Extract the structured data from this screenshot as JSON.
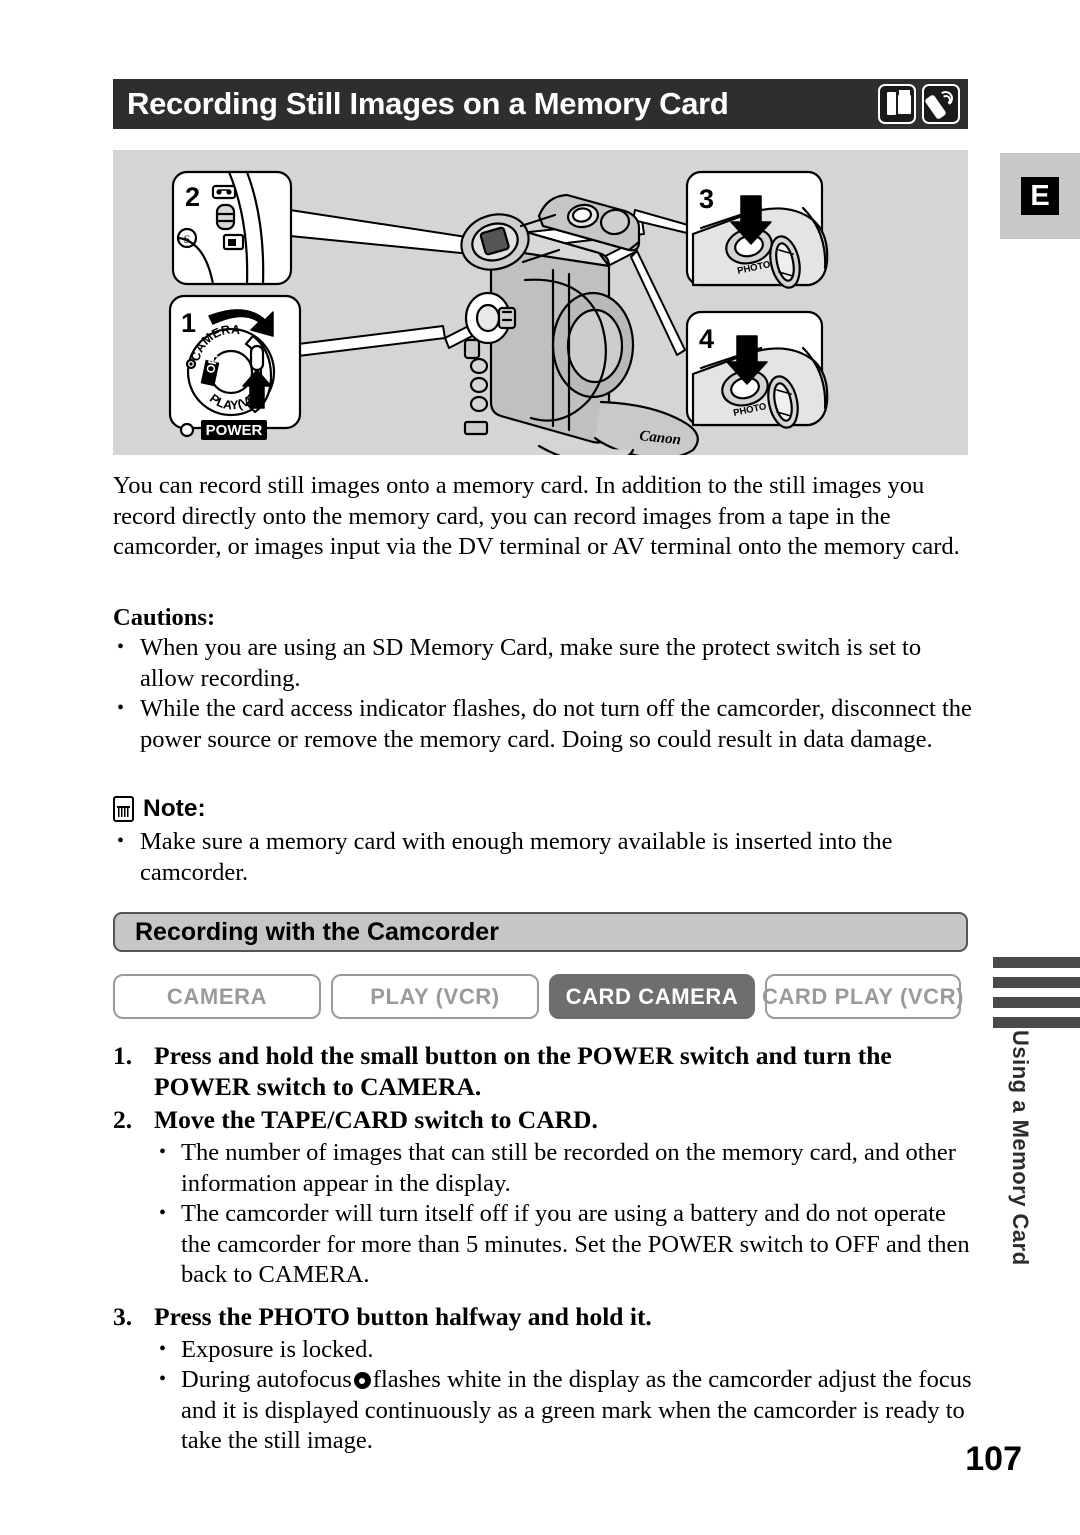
{
  "page": {
    "title": "Recording Still Images on a Memory Card",
    "number": "107",
    "language_tab": "E",
    "side_tab_text": "Using a Memory Card"
  },
  "header_icons": [
    {
      "name": "memory-card-icon",
      "label": "memory card"
    },
    {
      "name": "remote-control-icon",
      "label": "wireless remote"
    }
  ],
  "illustration": {
    "callouts": [
      {
        "number": "1",
        "label_power": "POWER",
        "dial_labels": [
          "CAMERA",
          "OFF",
          "PLAY(VCR)"
        ]
      },
      {
        "number": "2",
        "switch_labels": [
          "S"
        ]
      },
      {
        "number": "3",
        "button_label": "PHOTO"
      },
      {
        "number": "4",
        "button_label": "PHOTO"
      }
    ],
    "brand": "Canon"
  },
  "intro": "You can record still images onto a memory card. In addition to the still images you record directly onto the memory card, you can record images from a tape in the camcorder, or images input via the DV terminal or AV terminal onto the memory card.",
  "cautions": {
    "heading": "Cautions:",
    "items": [
      "When you are using an SD Memory Card, make sure the protect switch is set to allow recording.",
      "While the card access indicator flashes, do not turn off the camcorder, disconnect the power source or remove the memory card. Doing so could result in data damage."
    ]
  },
  "note": {
    "heading": "Note:",
    "icon": "memory-card-icon",
    "items": [
      "Make sure a memory card with enough memory available is inserted into the camcorder."
    ]
  },
  "section": {
    "heading": "Recording with the Camcorder"
  },
  "modes": [
    {
      "label": "CAMERA",
      "active": false
    },
    {
      "label": "PLAY (VCR)",
      "active": false
    },
    {
      "label": "CARD CAMERA",
      "active": true
    },
    {
      "label": "CARD PLAY (VCR)",
      "active": false
    }
  ],
  "steps": [
    {
      "number": "1.",
      "text": "Press and hold the small button on the POWER switch and turn the POWER switch to CAMERA.",
      "bullets": []
    },
    {
      "number": "2.",
      "text": "Move the TAPE/CARD switch to CARD.",
      "bullets": [
        "The number of images that can still be recorded on the memory card, and other information appear in the display.",
        "The camcorder will turn itself off if you are using a battery and do not operate the camcorder for more than 5 minutes. Set the POWER switch to OFF and then back to CAMERA."
      ]
    },
    {
      "number": "3.",
      "text": "Press the PHOTO button halfway and hold it.",
      "bullets": [
        "Exposure is locked."
      ],
      "bullet_autofocus_pre": "During autofocus",
      "bullet_autofocus_post": "flashes white in the display as the camcorder adjust the focus and it is displayed continuously as a green mark when the camcorder is ready to take the still image."
    }
  ],
  "colors": {
    "title_bar_bg": "#2e2e2e",
    "illustration_bg": "#d5d5d5",
    "section_bar_bg": "#c6c6c6",
    "mode_active_bg": "#6e6e6e",
    "mode_inactive_fg": "#9a9a9a",
    "side_bar_gray": "#4a4a4a",
    "e_tab_bg": "#c8c8c8"
  }
}
